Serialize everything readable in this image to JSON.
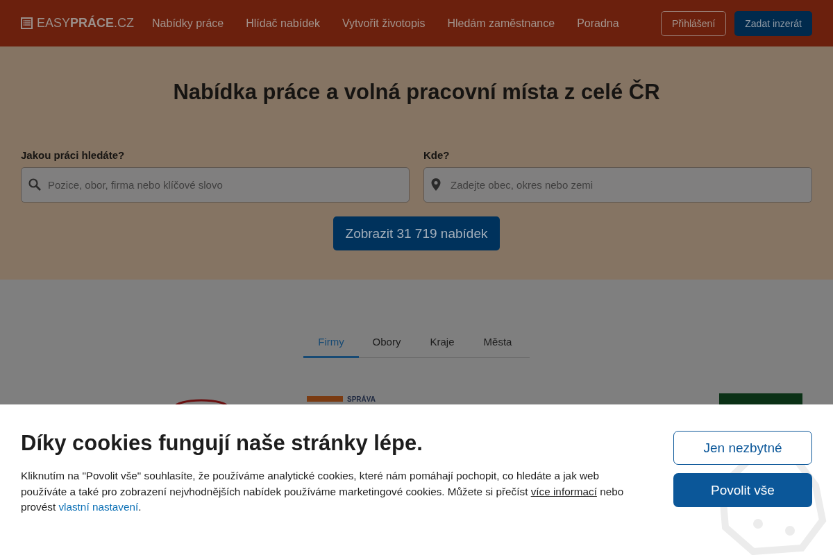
{
  "header": {
    "logo": {
      "light": "EASY",
      "bold": "PRÁCE",
      "suffix": ".CZ"
    },
    "nav": [
      "Nabídky práce",
      "Hlídač nabídek",
      "Vytvořit životopis",
      "Hledám zaměstnance",
      "Poradna"
    ],
    "buttons": [
      {
        "label": "Přihlášení",
        "kind": "outline"
      },
      {
        "label": "Zadat inzerát",
        "kind": "filled"
      }
    ]
  },
  "hero": {
    "title": "Nabídka práce a volná pracovní místa z celé ČR",
    "fields": [
      {
        "label": "Jakou práci hledáte?",
        "placeholder": "Pozice, obor, firma nebo klíčové slovo",
        "kind": "search"
      },
      {
        "label": "Kde?",
        "placeholder": "Zadejte obec, okres nebo zemi",
        "kind": "location"
      }
    ],
    "submit": "Zobrazit 31 719 nabídek"
  },
  "tabs": [
    {
      "label": "Firmy",
      "selected": true
    },
    {
      "label": "Obory",
      "selected": false
    },
    {
      "label": "Kraje",
      "selected": false
    },
    {
      "label": "Města",
      "selected": false
    }
  ],
  "firms": [
    {
      "kind": "ellipse"
    },
    {
      "kind": "text",
      "text": "SPRÁVA"
    },
    {
      "kind": "block"
    }
  ],
  "cookie_banner": {
    "title": "Díky cookies fungují naše stránky lépe.",
    "text": "Kliknutím na \"Povolit vše\" souhlasíte, že používáme analytické cookies, které nám pomáhají pochopit, co hledáte a jak web používáte a také pro zobrazení nejvhodnějších nabídek používáme marketingové cookies. Můžete si přečíst ",
    "link1": "více informací",
    "middle": " nebo provést ",
    "link2": "vlastní nastavení",
    "end": ".",
    "buttons": [
      {
        "label": "Jen nezbytné",
        "kind": "outline"
      },
      {
        "label": "Povolit vše",
        "kind": "filled"
      }
    ]
  }
}
